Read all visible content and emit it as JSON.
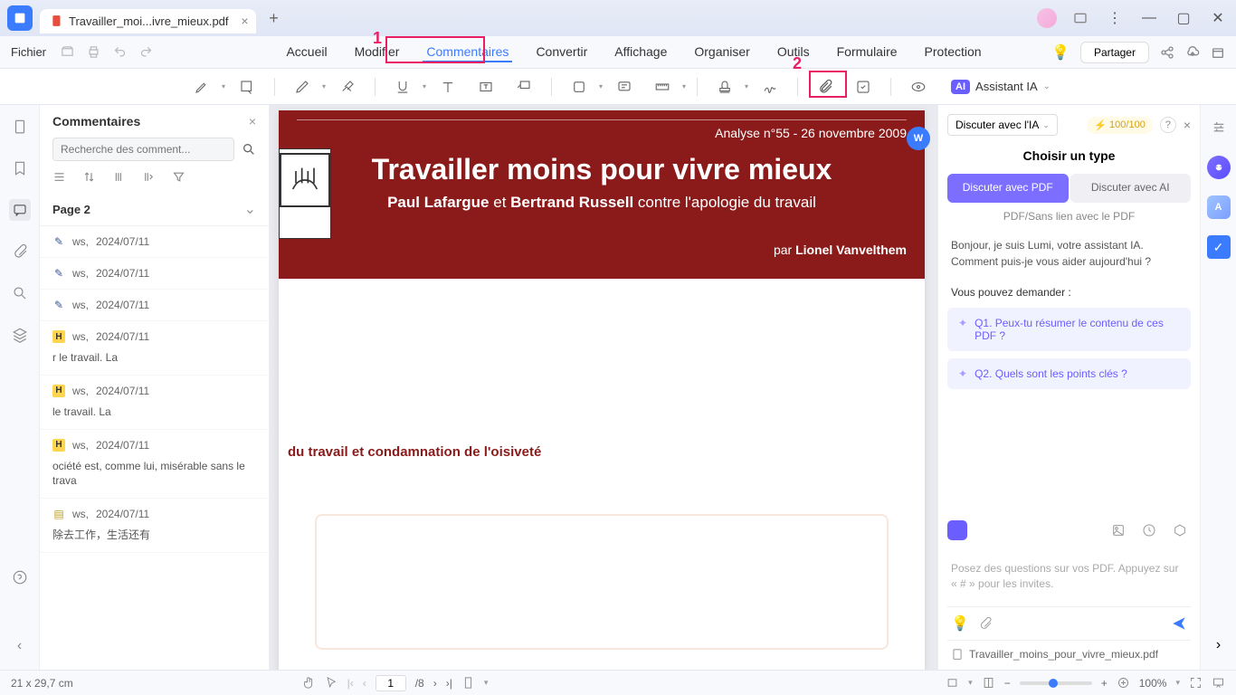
{
  "tab_title": "Travailler_moi...ivre_mieux.pdf",
  "menu": {
    "file": "Fichier",
    "items": [
      "Accueil",
      "Modifier",
      "Commentaires",
      "Convertir",
      "Affichage",
      "Organiser",
      "Outils",
      "Formulaire",
      "Protection"
    ],
    "active": 2,
    "share": "Partager"
  },
  "ai_assistant_label": "Assistant IA",
  "comments_panel": {
    "title": "Commentaires",
    "search_placeholder": "Recherche des comment...",
    "page_label": "Page 2",
    "items": [
      {
        "icon": "pencil",
        "author": "ws,",
        "date": "2024/07/11",
        "text": ""
      },
      {
        "icon": "pencil",
        "author": "ws,",
        "date": "2024/07/11",
        "text": ""
      },
      {
        "icon": "pencil",
        "author": "ws,",
        "date": "2024/07/11",
        "text": ""
      },
      {
        "icon": "highlight",
        "author": "ws,",
        "date": "2024/07/11",
        "text": "r le travail. La"
      },
      {
        "icon": "highlight",
        "author": "ws,",
        "date": "2024/07/11",
        "text": "le travail. La"
      },
      {
        "icon": "highlight",
        "author": "ws,",
        "date": "2024/07/11",
        "text": "ociété est, comme lui, misérable sans le trava"
      },
      {
        "icon": "note",
        "author": "ws,",
        "date": "2024/07/11",
        "text": "除去工作，生活还有"
      }
    ]
  },
  "document": {
    "analyse": "Analyse n°55 - 26 novembre 2009",
    "title": "Travailler moins pour vivre mieux",
    "subtitle_strong1": "Paul Lafargue",
    "subtitle_and": " et ",
    "subtitle_strong2": "Bertrand Russell",
    "subtitle_rest": " contre l'apologie du travail",
    "author_prefix": "par ",
    "author": "Lionel Vanvelthem",
    "section": "du travail et condamnation de l'oisiveté"
  },
  "ai_panel": {
    "dropdown": "Discuter avec l'IA",
    "tokens": "100/100",
    "type_title": "Choisir un type",
    "tab1": "Discuter avec PDF",
    "tab2": "Discuter avec AI",
    "subtitle": "PDF/Sans lien avec le PDF",
    "greeting": "Bonjour, je suis Lumi, votre assistant IA. Comment puis-je vous aider aujourd'hui ?",
    "prompt_label": "Vous pouvez demander :",
    "suggestions": [
      "Q1. Peux-tu résumer le contenu de ces PDF ?",
      "Q2. Quels sont les points clés ?"
    ],
    "placeholder": "Posez des questions sur vos PDF. Appuyez sur « # » pour les invites.",
    "filename": "Travailler_moins_pour_vivre_mieux.pdf"
  },
  "status": {
    "dimensions": "21 x 29,7 cm",
    "page_current": "1",
    "page_total": "/8",
    "zoom": "100%"
  },
  "callouts": {
    "c1": "1",
    "c2": "2"
  }
}
